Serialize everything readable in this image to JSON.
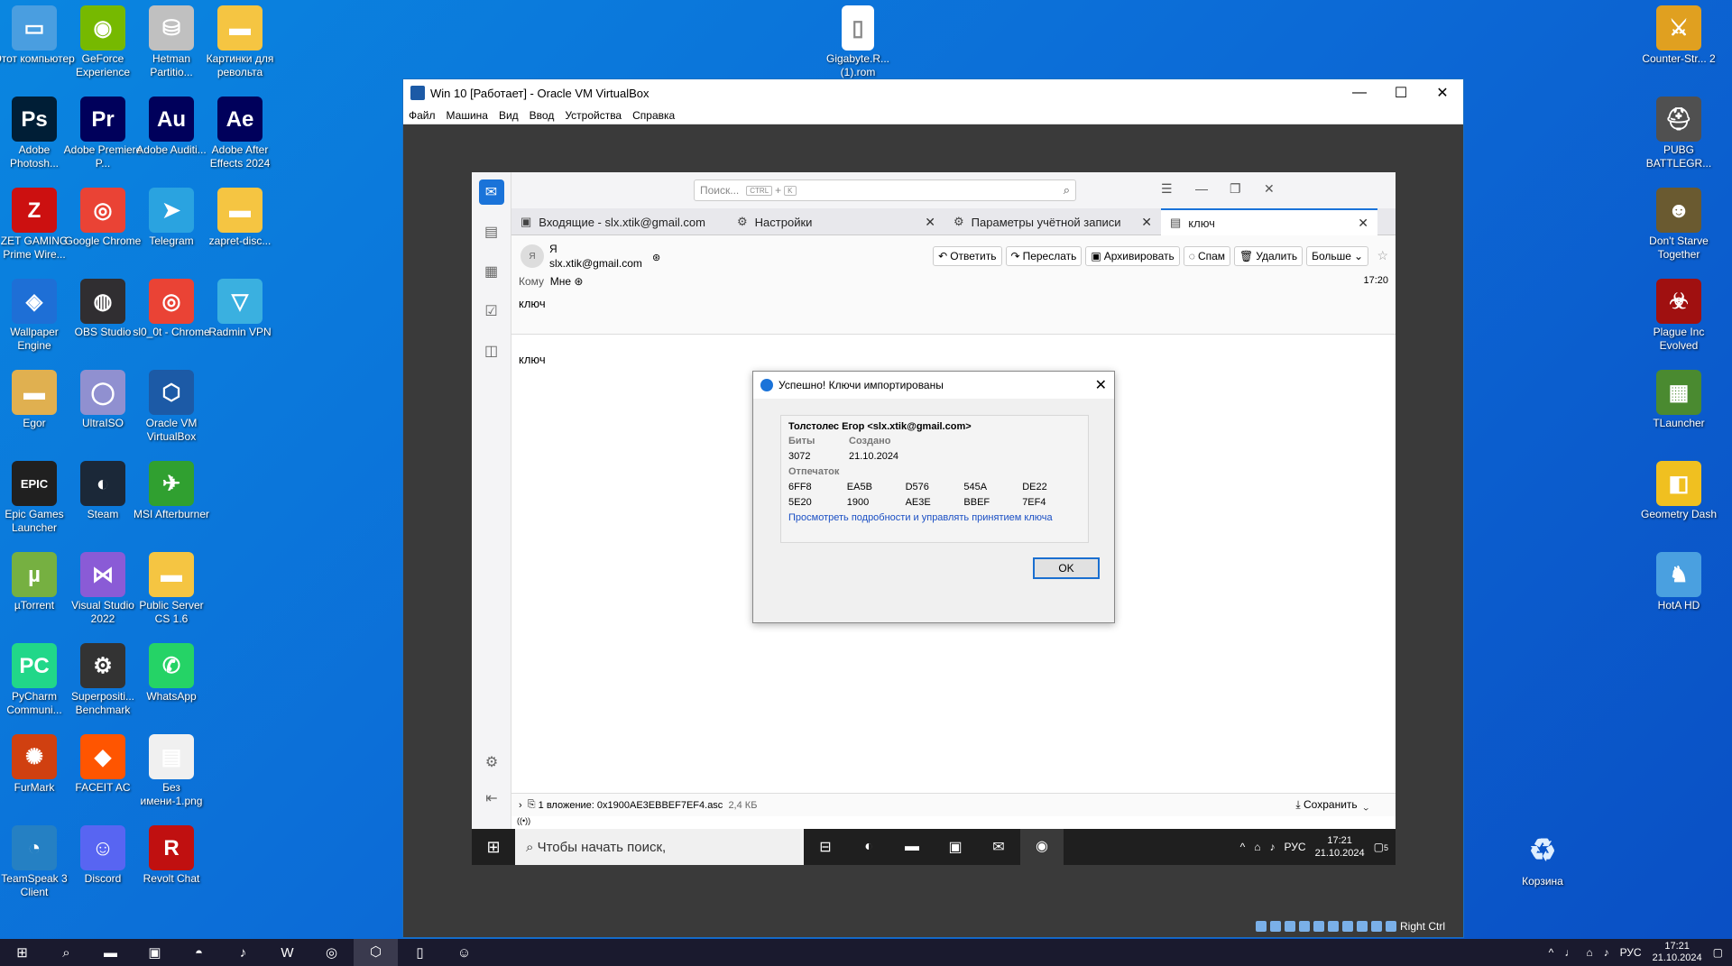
{
  "desktop_icons_left": [
    {
      "label": "Этот компьютер",
      "icon": "computer-icon",
      "color": "#4a9ee0",
      "glyph": "▭"
    },
    {
      "label": "GeForce Experience",
      "icon": "nvidia-icon",
      "color": "#76b900",
      "glyph": "◉"
    },
    {
      "label": "Hetman Partitio...",
      "icon": "hetman-icon",
      "color": "#c0c0c0",
      "glyph": "⛁"
    },
    {
      "label": "Картинки для револьта",
      "icon": "folder-icon",
      "color": "#f5c542",
      "glyph": "▬"
    },
    {
      "label": "Adobe Photosh...",
      "icon": "photoshop-icon",
      "color": "#001e36",
      "glyph": "Ps"
    },
    {
      "label": "Adobe Premiere P...",
      "icon": "premiere-icon",
      "color": "#00005b",
      "glyph": "Pr"
    },
    {
      "label": "Adobe Auditi...",
      "icon": "audition-icon",
      "color": "#00005b",
      "glyph": "Au"
    },
    {
      "label": "Adobe After Effects 2024",
      "icon": "aftereffects-icon",
      "color": "#00005b",
      "glyph": "Ae"
    },
    {
      "label": "ZET GAMING Prime Wire...",
      "icon": "zet-icon",
      "color": "#cc1010",
      "glyph": "Z"
    },
    {
      "label": "Google Chrome",
      "icon": "chrome-icon",
      "color": "#ea4335",
      "glyph": "◎"
    },
    {
      "label": "Telegram",
      "icon": "telegram-icon",
      "color": "#2aa3e0",
      "glyph": "➤"
    },
    {
      "label": "zapret-disc...",
      "icon": "folder-icon",
      "color": "#f5c542",
      "glyph": "▬"
    },
    {
      "label": "Wallpaper Engine",
      "icon": "wallpaper-engine-icon",
      "color": "#1e6fd6",
      "glyph": "◈"
    },
    {
      "label": "OBS Studio",
      "icon": "obs-icon",
      "color": "#302e31",
      "glyph": "◍"
    },
    {
      "label": "sl0_0t - Chrome",
      "icon": "chrome-icon",
      "color": "#ea4335",
      "glyph": "◎"
    },
    {
      "label": "Radmin VPN",
      "icon": "radmin-icon",
      "color": "#3ab0e0",
      "glyph": "▽"
    },
    {
      "label": "Egor",
      "icon": "folder-icon",
      "color": "#e0b050",
      "glyph": "▬"
    },
    {
      "label": "UltraISO",
      "icon": "ultraiso-icon",
      "color": "#9090d0",
      "glyph": "◯"
    },
    {
      "label": "Oracle VM VirtualBox",
      "icon": "virtualbox-icon",
      "color": "#1c5aa6",
      "glyph": "⬡"
    },
    {
      "label": "Epic Games Launcher",
      "icon": "epic-icon",
      "color": "#202020",
      "glyph": "EPIC"
    },
    {
      "label": "Steam",
      "icon": "steam-icon",
      "color": "#1b2838",
      "glyph": "◐"
    },
    {
      "label": "MSI Afterburner",
      "icon": "msi-icon",
      "color": "#30a030",
      "glyph": "✈"
    },
    {
      "label": "µTorrent",
      "icon": "utorrent-icon",
      "color": "#76b041",
      "glyph": "µ"
    },
    {
      "label": "Visual Studio 2022",
      "icon": "visualstudio-icon",
      "color": "#8a5bd6",
      "glyph": "⋈"
    },
    {
      "label": "Public Server CS 1.6",
      "icon": "folder-icon",
      "color": "#f5c542",
      "glyph": "▬"
    },
    {
      "label": "PyCharm Communi...",
      "icon": "pycharm-icon",
      "color": "#21d789",
      "glyph": "PC"
    },
    {
      "label": "Superpositi... Benchmark",
      "icon": "superposition-icon",
      "color": "#333",
      "glyph": "⚙"
    },
    {
      "label": "WhatsApp",
      "icon": "whatsapp-icon",
      "color": "#25d366",
      "glyph": "✆"
    },
    {
      "label": "FurMark",
      "icon": "furmark-icon",
      "color": "#d04010",
      "glyph": "✺"
    },
    {
      "label": "FACEIT AC",
      "icon": "faceit-icon",
      "color": "#ff5500",
      "glyph": "◆"
    },
    {
      "label": "Без имени-1.png",
      "icon": "image-file-icon",
      "color": "#f0f0f0",
      "glyph": "▤"
    },
    {
      "label": "TeamSpeak 3 Client",
      "icon": "teamspeak-icon",
      "color": "#2580c3",
      "glyph": "◔"
    },
    {
      "label": "Discord",
      "icon": "discord-icon",
      "color": "#5865f2",
      "glyph": "☺"
    },
    {
      "label": "Revolt Chat",
      "icon": "revolt-icon",
      "color": "#c01010",
      "glyph": "R"
    }
  ],
  "desktop_icons_right": [
    {
      "label": "Counter-Str... 2",
      "icon": "cs2-icon",
      "color": "#e0a020",
      "glyph": "⚔"
    },
    {
      "label": "PUBG BATTLEGR...",
      "icon": "pubg-icon",
      "color": "#505050",
      "glyph": "⛑"
    },
    {
      "label": "Don't Starve Together",
      "icon": "dst-icon",
      "color": "#6a5a30",
      "glyph": "☻"
    },
    {
      "label": "Plague Inc Evolved",
      "icon": "plague-icon",
      "color": "#a01010",
      "glyph": "☣"
    },
    {
      "label": "TLauncher",
      "icon": "tlauncher-icon",
      "color": "#4a8a30",
      "glyph": "▦"
    },
    {
      "label": "Geometry Dash",
      "icon": "geometry-dash-icon",
      "color": "#f0c020",
      "glyph": "◧"
    },
    {
      "label": "HotA HD",
      "icon": "hota-icon",
      "color": "#4aa0e0",
      "glyph": "♞"
    }
  ],
  "desktop_file_top": {
    "label": "Gigabyte.R... (1).rom",
    "icon": "file-icon"
  },
  "recycle_bin": {
    "label": "Корзина",
    "icon": "recycle-bin-icon"
  },
  "vbox": {
    "title": "Win 10 [Работает] - Oracle VM VirtualBox",
    "menu": [
      "Файл",
      "Машина",
      "Вид",
      "Ввод",
      "Устройства",
      "Справка"
    ],
    "host_key": "Right Ctrl"
  },
  "thunderbird": {
    "search_placeholder": "Поиск...",
    "search_kbd1": "CTRL",
    "search_plus": "+",
    "search_kbd2": "K",
    "tabs": [
      {
        "label": "Входящие - slx.xtik@gmail.com",
        "icon": "inbox-icon",
        "closable": false
      },
      {
        "label": "Настройки",
        "icon": "gear-icon",
        "closable": true
      },
      {
        "label": "Параметры учётной записи",
        "icon": "account-icon",
        "closable": true
      },
      {
        "label": "ключ",
        "icon": "message-icon",
        "closable": true
      }
    ],
    "avatar_letter": "Я",
    "from_name": "Я",
    "from_email": "slx.xtik@gmail.com",
    "actions": [
      "Ответить",
      "Переслать",
      "Архивировать",
      "Спам",
      "Удалить",
      "Больше"
    ],
    "to_label": "Кому",
    "to_value": "Мне",
    "time": "17:20",
    "subject": "ключ",
    "body": "ключ",
    "attachment": "1 вложение: 0x1900AE3EBBEF7EF4.asc",
    "attachment_size": "2,4 КБ",
    "save_label": "Сохранить"
  },
  "dialog": {
    "title": "Успешно! Ключи импортированы",
    "owner": "Толстолес Егор <slx.xtik@gmail.com>",
    "bits_label": "Биты",
    "created_label": "Создано",
    "bits": "3072",
    "created": "21.10.2024",
    "fingerprint_label": "Отпечаток",
    "fp_row1": [
      "6FF8",
      "EA5B",
      "D576",
      "545A",
      "DE22"
    ],
    "fp_row2": [
      "5E20",
      "1900",
      "AE3E",
      "BBEF",
      "7EF4"
    ],
    "link": "Просмотреть подробности и управлять принятием ключа",
    "ok": "OK"
  },
  "guest_taskbar": {
    "search_placeholder": "Чтобы начать поиск,",
    "lang": "РУС",
    "time": "17:21",
    "date": "21.10.2024",
    "notif_count": "5"
  },
  "host_taskbar": {
    "lang": "РУС",
    "time": "17:21",
    "date": "21.10.2024"
  }
}
